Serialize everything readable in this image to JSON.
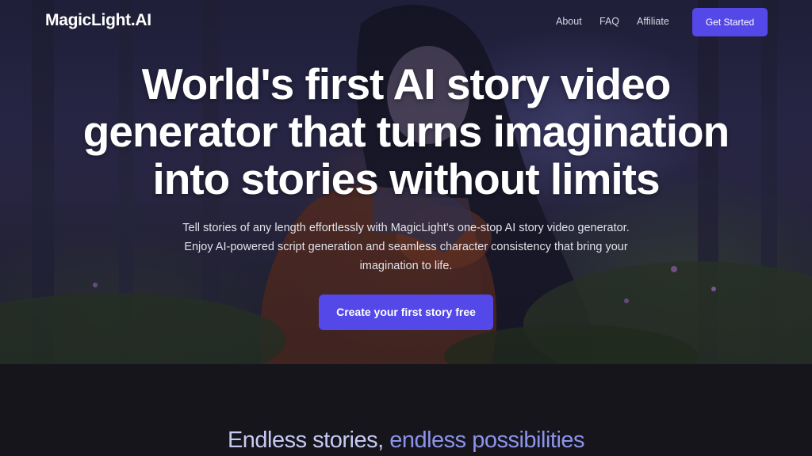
{
  "nav": {
    "logo": "MagicLight.AI",
    "links": [
      "About",
      "FAQ",
      "Affiliate"
    ],
    "cta": "Get Started"
  },
  "hero": {
    "headline_lines": [
      "World's first AI story video",
      "generator that turns imagination",
      "into stories without limits"
    ],
    "subtext_lines": [
      "Tell stories of any length effortlessly with MagicLight's one-stop AI story video generator.",
      "Enjoy AI-powered script generation and seamless character consistency that bring your",
      "imagination to life."
    ],
    "cta": "Create your first story free",
    "background_image": "girl-hugging-fox-in-dark-forest"
  },
  "section": {
    "title_part1": "Endless stories, ",
    "title_part2": "endless possibilities"
  },
  "colors": {
    "accent": "#5448e8",
    "page_background": "#15151b",
    "title_light": "#c7c9f3",
    "title_accent": "#8d93ec"
  }
}
